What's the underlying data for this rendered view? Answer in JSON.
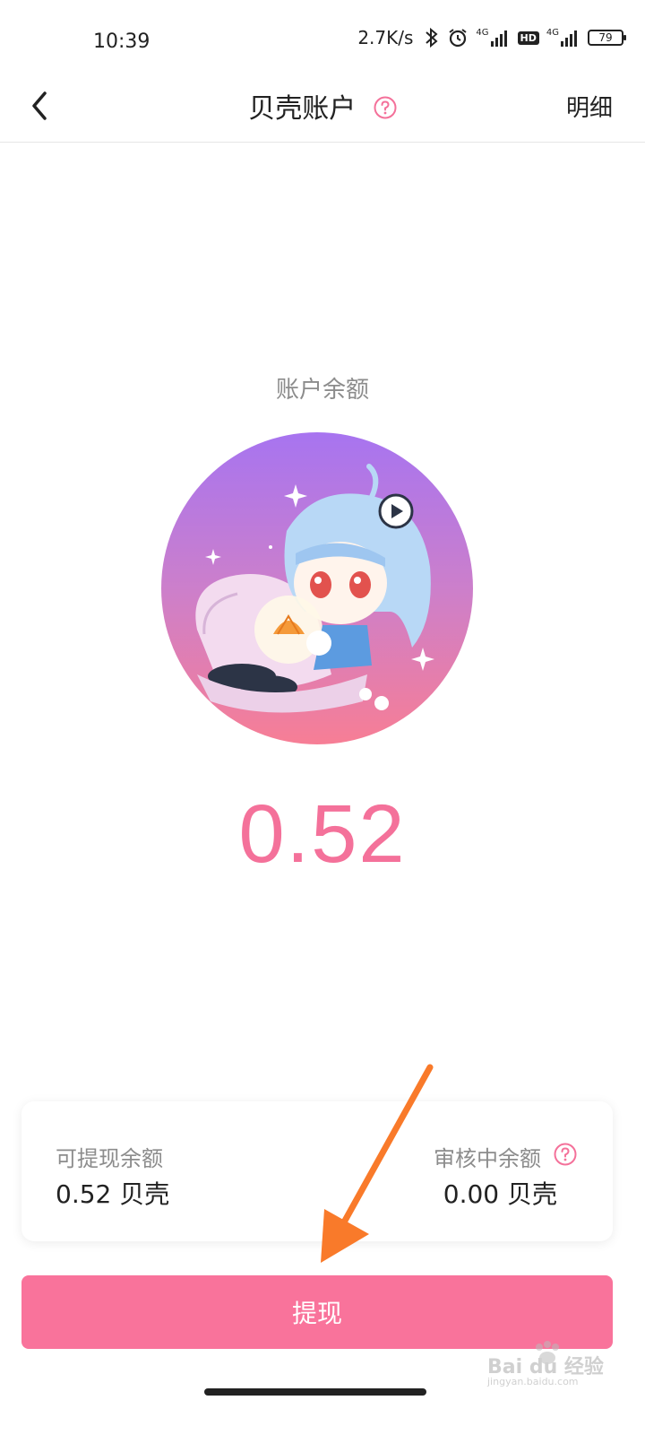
{
  "status_bar": {
    "time": "10:39",
    "net_speed": "2.7K/s",
    "hd_label": "HD",
    "battery": "79",
    "network_1": "4G",
    "network_2": "4G"
  },
  "header": {
    "title": "贝壳账户",
    "detail_label": "明细"
  },
  "main": {
    "balance_label": "账户余额",
    "balance_value": "0.52"
  },
  "summary": {
    "withdrawable_label": "可提现余额",
    "withdrawable_value": "0.52 贝壳",
    "pending_label": "审核中余额",
    "pending_value": "0.00 贝壳"
  },
  "withdraw_button": {
    "label": "提现"
  },
  "watermark": {
    "text": "Bai du 经验",
    "subtext": "jingyan.baidu.com"
  },
  "colors": {
    "accent": "#f4719a",
    "button": "#f9739b",
    "arrow": "#f97a2a",
    "gradient_top": "#a774f0",
    "gradient_bottom": "#f77e95"
  }
}
